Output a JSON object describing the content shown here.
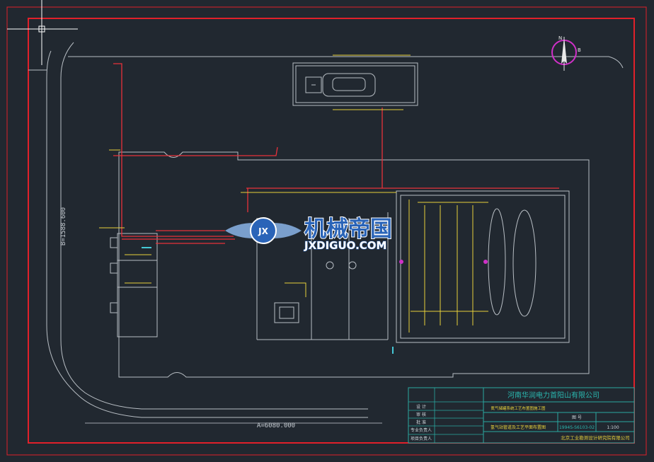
{
  "colors": {
    "background": "#212830",
    "frame": "#e0202a",
    "site_outline": "#b8bec4",
    "pipe_red": "#e8313a",
    "pipe_yellow": "#e8d13a",
    "cyan": "#45c8d6",
    "magenta": "#d030c8",
    "watermark_blue": "#2a64b8"
  },
  "dimensions": {
    "vertical": "B=1588.600",
    "horizontal": "A=6080.000"
  },
  "compass": {
    "north": "N",
    "east": "B"
  },
  "watermark": {
    "logo_text": "JX",
    "title": "机械帝国",
    "url": "JXDIGUO.COM"
  },
  "title_block": {
    "company": "河南华润电力首阳山有限公司",
    "project_title": "氮气储罐系统工艺布置图施工图",
    "drawing_title": "氢气站管道及工艺平面布置图",
    "design_institute": "北京工业勘测设计研究院有限公司",
    "drawing_no_label": "图 号",
    "drawing_no": "1994S-S6103-02",
    "scale": "1:100",
    "rows": [
      {
        "label": "设 计"
      },
      {
        "label": "审 核"
      },
      {
        "label": "批 准"
      },
      {
        "label": "专业负责人"
      },
      {
        "label": "项目负责人"
      }
    ]
  }
}
